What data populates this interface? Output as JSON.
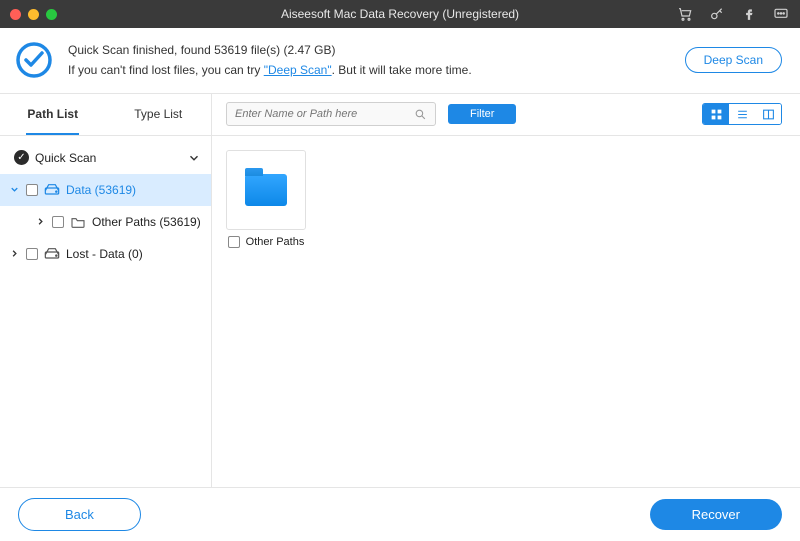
{
  "title": "Aiseesoft Mac Data Recovery (Unregistered)",
  "status": {
    "line1_prefix": "Quick Scan finished, found ",
    "file_count": "53619",
    "files_word": " file(s) ",
    "size": "(2.47 GB)",
    "line2_prefix": "If you can't find lost files, you can try ",
    "deep_scan_link": "\"Deep Scan\"",
    "line2_suffix": ". But it will take more time."
  },
  "deep_scan_btn": "Deep Scan",
  "tabs": {
    "path_list": "Path List",
    "type_list": "Type List"
  },
  "tree": {
    "quick_scan": "Quick Scan",
    "data": "Data (53619)",
    "other_paths": "Other Paths (53619)",
    "lost_data": "Lost - Data (0)"
  },
  "toolbar": {
    "search_placeholder": "Enter Name or Path here",
    "filter": "Filter"
  },
  "grid": {
    "item1": "Other Paths"
  },
  "footer": {
    "back": "Back",
    "recover": "Recover"
  }
}
